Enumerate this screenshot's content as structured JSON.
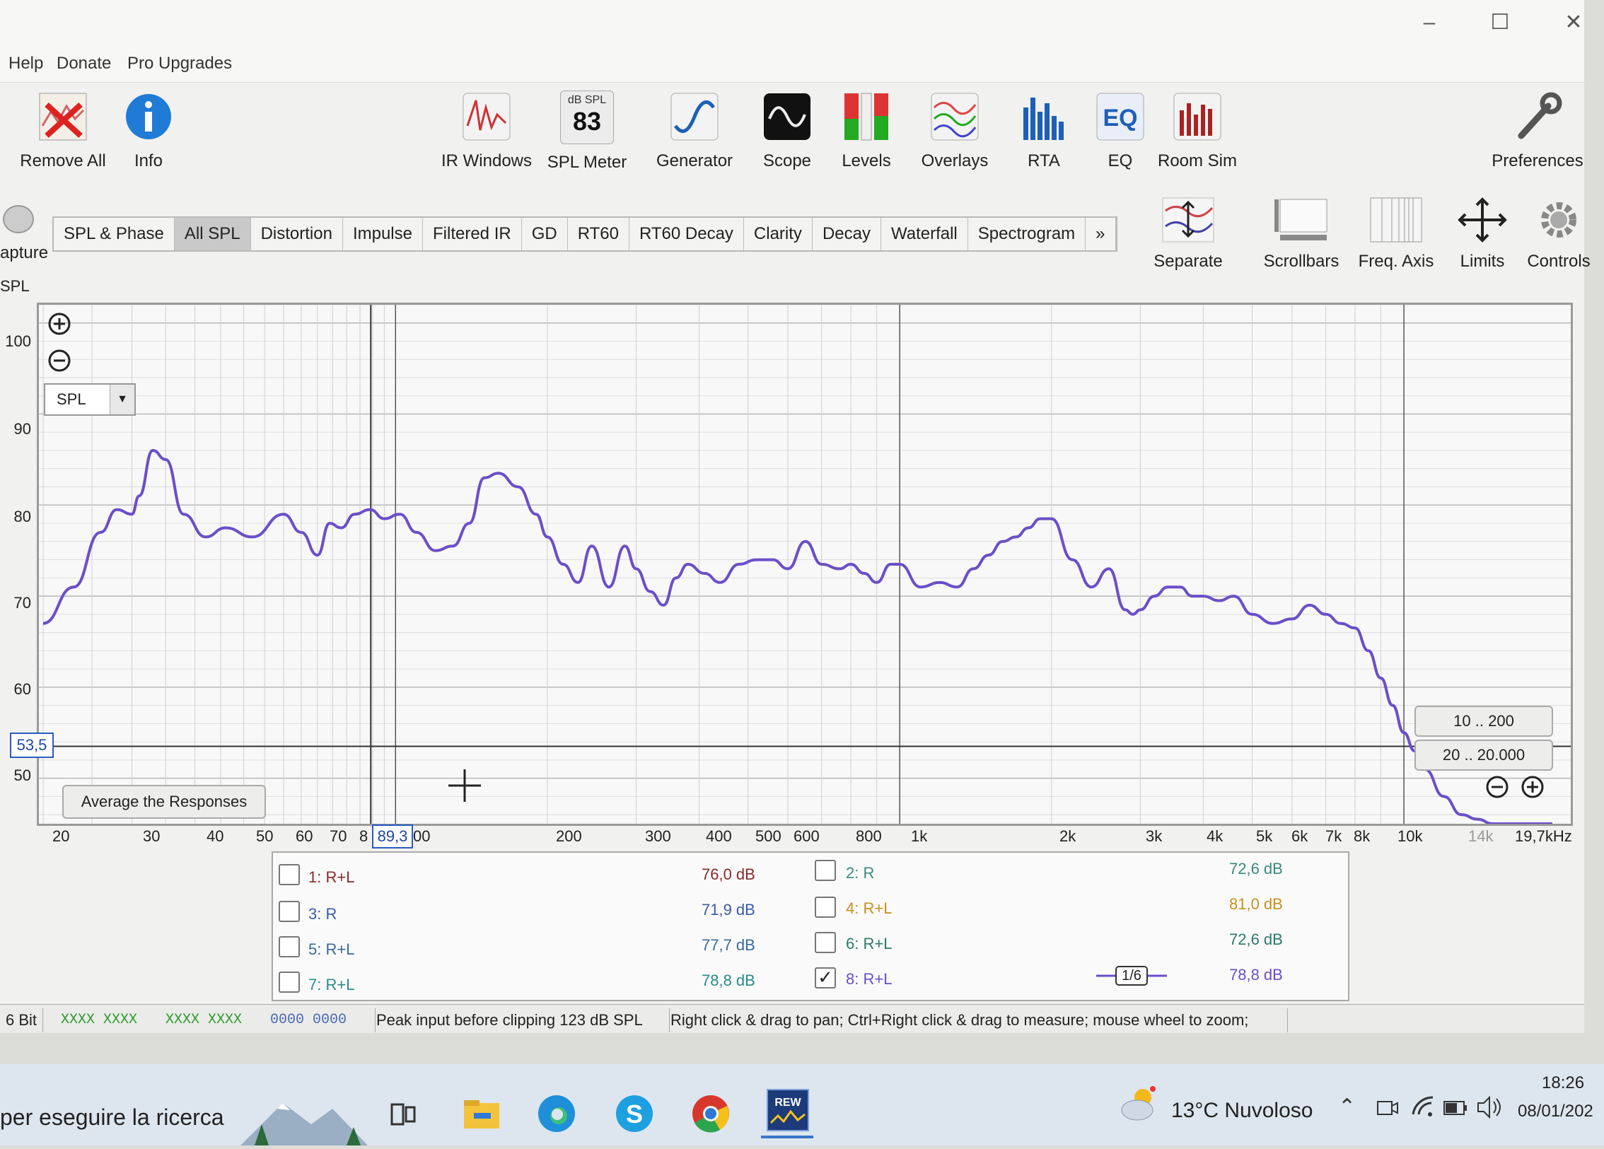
{
  "menu": [
    "Help",
    "Donate",
    "Pro Upgrades"
  ],
  "window_controls": [
    "–",
    "☐",
    "✕"
  ],
  "toolbar_left": [
    {
      "label": "Remove All",
      "icon": "remove-all-icon"
    },
    {
      "label": "Info",
      "icon": "info-icon"
    }
  ],
  "toolbar": [
    {
      "label": "IR Windows",
      "icon": "ir-windows-icon"
    },
    {
      "label": "SPL Meter",
      "icon": "spl-meter-icon",
      "unit": "dB SPL",
      "reading": "83"
    },
    {
      "label": "Generator",
      "icon": "generator-icon"
    },
    {
      "label": "Scope",
      "icon": "scope-icon"
    },
    {
      "label": "Levels",
      "icon": "levels-icon"
    },
    {
      "label": "Overlays",
      "icon": "overlays-icon"
    },
    {
      "label": "RTA",
      "icon": "rta-icon"
    },
    {
      "label": "EQ",
      "icon": "eq-icon"
    },
    {
      "label": "Room Sim",
      "icon": "room-sim-icon"
    }
  ],
  "preferences_label": "Preferences",
  "left_edge": {
    "capture": "apture",
    "spl": "SPL"
  },
  "tabs": [
    "SPL & Phase",
    "All SPL",
    "Distortion",
    "Impulse",
    "Filtered IR",
    "GD",
    "RT60",
    "RT60 Decay",
    "Clarity",
    "Decay",
    "Waterfall",
    "Spectrogram",
    "»"
  ],
  "active_tab": "All SPL",
  "graph_controls": [
    {
      "label": "Separate",
      "icon": "separate-icon"
    },
    {
      "label": "Scrollbars",
      "icon": "scrollbars-icon"
    },
    {
      "label": "Freq. Axis",
      "icon": "freq-axis-icon"
    },
    {
      "label": "Limits",
      "icon": "limits-icon"
    },
    {
      "label": "Controls",
      "icon": "controls-gear-icon"
    }
  ],
  "graph": {
    "y_selector": "SPL",
    "cursor_y": "53,5",
    "cursor_x": "89,3",
    "average_button": "Average the Responses",
    "range_buttons": [
      "10 .. 200",
      "20 .. 20.000"
    ],
    "y_ticks": [
      "100",
      "90",
      "80",
      "70",
      "60",
      "50"
    ],
    "x_ticks": [
      "20",
      "30",
      "40",
      "50",
      "60",
      "70",
      "8",
      "00",
      "200",
      "300",
      "400",
      "500",
      "600",
      "800",
      "1k",
      "2k",
      "3k",
      "4k",
      "5k",
      "6k",
      "7k",
      "8k",
      "10k",
      "14k",
      "19,7kHz"
    ]
  },
  "chart_data": {
    "type": "line",
    "x_scale": "log",
    "xlim": [
      20,
      19700
    ],
    "ylim": [
      45,
      102
    ],
    "series": [
      {
        "name": "8: R+L",
        "color": "#6a4fc7",
        "x": [
          20,
          23,
          26,
          28,
          30,
          31,
          33,
          35,
          38,
          42,
          46,
          52,
          60,
          65,
          70,
          74,
          78,
          83,
          89,
          95,
          102,
          110,
          120,
          130,
          140,
          150,
          160,
          175,
          190,
          200,
          215,
          230,
          245,
          265,
          285,
          300,
          320,
          340,
          360,
          380,
          410,
          440,
          480,
          520,
          560,
          600,
          650,
          700,
          760,
          800,
          850,
          900,
          960,
          1000,
          1100,
          1200,
          1300,
          1400,
          1500,
          1600,
          1700,
          1800,
          1900,
          2000,
          2200,
          2400,
          2600,
          2800,
          2900,
          3000,
          3200,
          3400,
          3600,
          3800,
          4000,
          4300,
          4600,
          5000,
          5500,
          6000,
          6500,
          7000,
          7500,
          8000,
          8500,
          9000,
          9500,
          10000,
          10500,
          11000,
          12000,
          13000,
          14000,
          15000,
          16000,
          17000,
          18000,
          19000,
          19700
        ],
        "y": [
          67,
          71,
          77,
          79.5,
          79,
          81,
          86,
          85,
          79,
          76.5,
          77.5,
          76.5,
          79,
          77,
          74.5,
          78,
          77.5,
          79,
          79.5,
          78.5,
          79,
          77,
          75,
          75.5,
          78,
          83,
          83.5,
          82,
          79,
          76.5,
          73.5,
          71.5,
          75.5,
          71,
          75.5,
          73,
          70.5,
          69,
          72,
          73.5,
          72.5,
          71.5,
          73.5,
          74,
          74,
          73,
          76,
          73.5,
          73,
          73.5,
          72.5,
          71.5,
          73.5,
          73.5,
          71,
          71.5,
          71,
          73,
          74.5,
          76,
          76.5,
          77.5,
          78.5,
          78.5,
          74,
          71,
          73,
          68.5,
          68,
          68.5,
          70,
          71,
          71,
          70,
          70,
          69.5,
          70,
          68,
          67,
          67.5,
          69,
          68,
          67,
          66.5,
          64,
          61,
          58,
          55,
          53,
          51,
          48,
          46,
          45.5,
          45,
          45,
          45,
          45,
          45,
          45
        ]
      }
    ]
  },
  "legend": [
    {
      "name": "1: R+L",
      "value": "76,0 dB",
      "checked": false,
      "color": "#8a2a2a"
    },
    {
      "name": "2: R",
      "value": "72,6 dB",
      "checked": false,
      "color": "#3a8a7a"
    },
    {
      "name": "3: R",
      "value": "71,9 dB",
      "checked": false,
      "color": "#3a5aa8"
    },
    {
      "name": "4: R+L",
      "value": "81,0 dB",
      "checked": false,
      "color": "#c9901e"
    },
    {
      "name": "5: R+L",
      "value": "77,7 dB",
      "checked": false,
      "color": "#3a6a9a"
    },
    {
      "name": "6: R+L",
      "value": "72,6 dB",
      "checked": false,
      "color": "#2a7a6a"
    },
    {
      "name": "7: R+L",
      "value": "78,8 dB",
      "checked": false,
      "color": "#2a8a8a"
    },
    {
      "name": "8: R+L",
      "value": "78,8 dB",
      "checked": true,
      "color": "#6a4fc7",
      "smoothing": "1/6"
    }
  ],
  "status": {
    "bits": "6 Bit",
    "meters1": "XXXX XXXX",
    "meters2": "XXXX XXXX",
    "meters3": "0000 0000",
    "peak": "Peak input before clipping 123 dB SPL",
    "hint": "Right click & drag to pan; Ctrl+Right click & drag to measure; mouse wheel to zoom;"
  },
  "taskbar": {
    "search": "per eseguire la ricerca",
    "weather": "13°C  Nuvoloso",
    "time": "18:26",
    "date": "08/01/202"
  }
}
